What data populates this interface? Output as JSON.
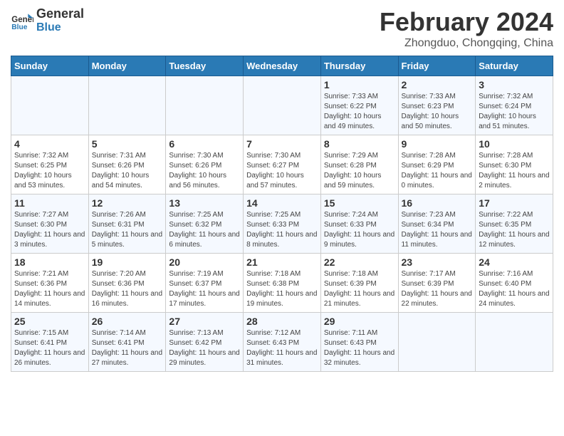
{
  "header": {
    "logo_line1": "General",
    "logo_line2": "Blue",
    "main_title": "February 2024",
    "subtitle": "Zhongduo, Chongqing, China"
  },
  "calendar": {
    "days_of_week": [
      "Sunday",
      "Monday",
      "Tuesday",
      "Wednesday",
      "Thursday",
      "Friday",
      "Saturday"
    ],
    "weeks": [
      [
        {
          "day": "",
          "info": ""
        },
        {
          "day": "",
          "info": ""
        },
        {
          "day": "",
          "info": ""
        },
        {
          "day": "",
          "info": ""
        },
        {
          "day": "1",
          "info": "Sunrise: 7:33 AM\nSunset: 6:22 PM\nDaylight: 10 hours and 49 minutes."
        },
        {
          "day": "2",
          "info": "Sunrise: 7:33 AM\nSunset: 6:23 PM\nDaylight: 10 hours and 50 minutes."
        },
        {
          "day": "3",
          "info": "Sunrise: 7:32 AM\nSunset: 6:24 PM\nDaylight: 10 hours and 51 minutes."
        }
      ],
      [
        {
          "day": "4",
          "info": "Sunrise: 7:32 AM\nSunset: 6:25 PM\nDaylight: 10 hours and 53 minutes."
        },
        {
          "day": "5",
          "info": "Sunrise: 7:31 AM\nSunset: 6:26 PM\nDaylight: 10 hours and 54 minutes."
        },
        {
          "day": "6",
          "info": "Sunrise: 7:30 AM\nSunset: 6:26 PM\nDaylight: 10 hours and 56 minutes."
        },
        {
          "day": "7",
          "info": "Sunrise: 7:30 AM\nSunset: 6:27 PM\nDaylight: 10 hours and 57 minutes."
        },
        {
          "day": "8",
          "info": "Sunrise: 7:29 AM\nSunset: 6:28 PM\nDaylight: 10 hours and 59 minutes."
        },
        {
          "day": "9",
          "info": "Sunrise: 7:28 AM\nSunset: 6:29 PM\nDaylight: 11 hours and 0 minutes."
        },
        {
          "day": "10",
          "info": "Sunrise: 7:28 AM\nSunset: 6:30 PM\nDaylight: 11 hours and 2 minutes."
        }
      ],
      [
        {
          "day": "11",
          "info": "Sunrise: 7:27 AM\nSunset: 6:30 PM\nDaylight: 11 hours and 3 minutes."
        },
        {
          "day": "12",
          "info": "Sunrise: 7:26 AM\nSunset: 6:31 PM\nDaylight: 11 hours and 5 minutes."
        },
        {
          "day": "13",
          "info": "Sunrise: 7:25 AM\nSunset: 6:32 PM\nDaylight: 11 hours and 6 minutes."
        },
        {
          "day": "14",
          "info": "Sunrise: 7:25 AM\nSunset: 6:33 PM\nDaylight: 11 hours and 8 minutes."
        },
        {
          "day": "15",
          "info": "Sunrise: 7:24 AM\nSunset: 6:33 PM\nDaylight: 11 hours and 9 minutes."
        },
        {
          "day": "16",
          "info": "Sunrise: 7:23 AM\nSunset: 6:34 PM\nDaylight: 11 hours and 11 minutes."
        },
        {
          "day": "17",
          "info": "Sunrise: 7:22 AM\nSunset: 6:35 PM\nDaylight: 11 hours and 12 minutes."
        }
      ],
      [
        {
          "day": "18",
          "info": "Sunrise: 7:21 AM\nSunset: 6:36 PM\nDaylight: 11 hours and 14 minutes."
        },
        {
          "day": "19",
          "info": "Sunrise: 7:20 AM\nSunset: 6:36 PM\nDaylight: 11 hours and 16 minutes."
        },
        {
          "day": "20",
          "info": "Sunrise: 7:19 AM\nSunset: 6:37 PM\nDaylight: 11 hours and 17 minutes."
        },
        {
          "day": "21",
          "info": "Sunrise: 7:18 AM\nSunset: 6:38 PM\nDaylight: 11 hours and 19 minutes."
        },
        {
          "day": "22",
          "info": "Sunrise: 7:18 AM\nSunset: 6:39 PM\nDaylight: 11 hours and 21 minutes."
        },
        {
          "day": "23",
          "info": "Sunrise: 7:17 AM\nSunset: 6:39 PM\nDaylight: 11 hours and 22 minutes."
        },
        {
          "day": "24",
          "info": "Sunrise: 7:16 AM\nSunset: 6:40 PM\nDaylight: 11 hours and 24 minutes."
        }
      ],
      [
        {
          "day": "25",
          "info": "Sunrise: 7:15 AM\nSunset: 6:41 PM\nDaylight: 11 hours and 26 minutes."
        },
        {
          "day": "26",
          "info": "Sunrise: 7:14 AM\nSunset: 6:41 PM\nDaylight: 11 hours and 27 minutes."
        },
        {
          "day": "27",
          "info": "Sunrise: 7:13 AM\nSunset: 6:42 PM\nDaylight: 11 hours and 29 minutes."
        },
        {
          "day": "28",
          "info": "Sunrise: 7:12 AM\nSunset: 6:43 PM\nDaylight: 11 hours and 31 minutes."
        },
        {
          "day": "29",
          "info": "Sunrise: 7:11 AM\nSunset: 6:43 PM\nDaylight: 11 hours and 32 minutes."
        },
        {
          "day": "",
          "info": ""
        },
        {
          "day": "",
          "info": ""
        }
      ]
    ]
  }
}
